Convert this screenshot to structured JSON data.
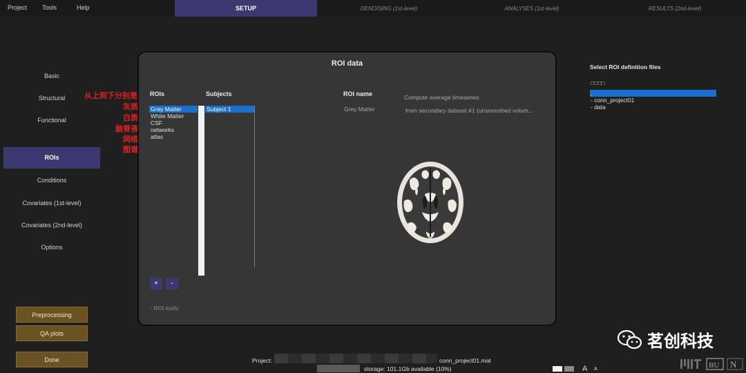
{
  "menu": [
    "Project",
    "Tools",
    "Help"
  ],
  "tabs": [
    {
      "label": "SETUP",
      "active": true
    },
    {
      "label": "DENOISING (1st-level)",
      "active": false
    },
    {
      "label": "ANALYSES (1st-level)",
      "active": false
    },
    {
      "label": "RESULTS (2nd-level)",
      "active": false
    }
  ],
  "nav": [
    "Basic",
    "Structural",
    "Functional",
    "ROIs",
    "Conditions",
    "Covariates (1st-level)",
    "Covariates (2nd-level)",
    "Options"
  ],
  "annotation": [
    "从上到下分别是：",
    "灰质",
    "白质",
    "脑脊液",
    "网络",
    "图谱"
  ],
  "buttons": {
    "preprocessing": "Preprocessing",
    "qa_plots": "QA plots",
    "done": "Done"
  },
  "dialog": {
    "title": "ROI data",
    "rois_header": "ROIs",
    "subjects_header": "Subjects",
    "roi_name_header": "ROI name",
    "rois": [
      "Grey Matter",
      "White Matter",
      "CSF",
      "networks",
      "atlas"
    ],
    "subjects": [
      "Subject 1"
    ],
    "roi_name_value": "Grey Matter",
    "compute_label": "Compute average timeseries",
    "source_label": "from secondary dataset #1 (unsmoothed volum...",
    "add_label": "+",
    "remove_label": "-",
    "roi_tools": "- ROI tools:"
  },
  "right_panel": {
    "title": "Select ROI definition files",
    "placeholder": "□□□□",
    "files": [
      ".",
      "- conn_project01",
      "- data"
    ]
  },
  "status": {
    "project_label": "Project:",
    "project_file": "conn_project01.mat",
    "storage": "storage: 101.1Gb available (10%)",
    "font_big": "A",
    "font_small": "A"
  },
  "watermark": "茗创科技",
  "colors": {
    "accent": "#3b3970",
    "selection": "#1a6fcf",
    "brown_button": "#6b5223",
    "annotation": "#e02020"
  }
}
